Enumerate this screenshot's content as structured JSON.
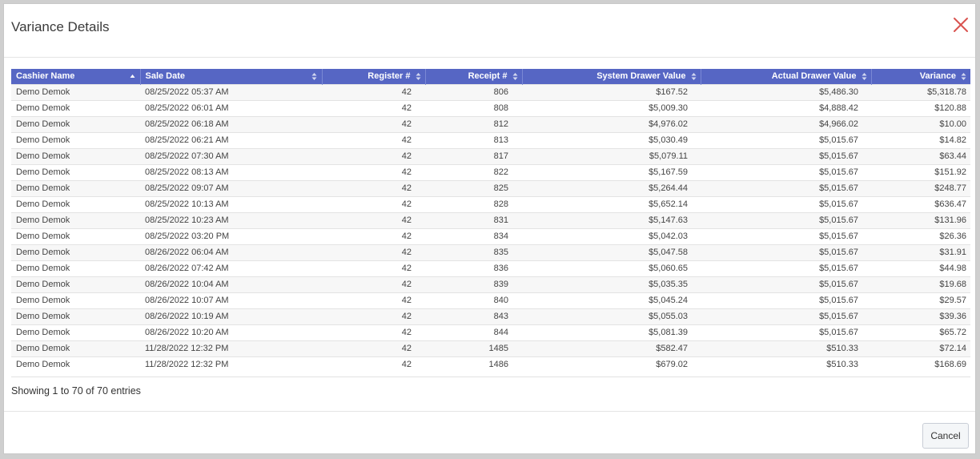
{
  "dialog": {
    "title": "Variance Details",
    "info_text": "Showing 1 to 70 of 70 entries",
    "cancel_label": "Cancel"
  },
  "colors": {
    "header_bg": "#5666c4",
    "close": "#d9534f"
  },
  "table": {
    "columns": [
      {
        "label": "Cashier Name",
        "key": "cashier",
        "align": "left"
      },
      {
        "label": "Sale Date",
        "key": "date",
        "align": "left"
      },
      {
        "label": "Register #",
        "key": "register",
        "align": "right"
      },
      {
        "label": "Receipt #",
        "key": "receipt",
        "align": "right"
      },
      {
        "label": "System Drawer Value",
        "key": "system",
        "align": "right"
      },
      {
        "label": "Actual Drawer Value",
        "key": "actual",
        "align": "right"
      },
      {
        "label": "Variance",
        "key": "variance",
        "align": "right"
      }
    ],
    "rows": [
      {
        "cashier": "Demo Demok",
        "date": "08/25/2022 05:37 AM",
        "register": "42",
        "receipt": "806",
        "system": "$167.52",
        "actual": "$5,486.30",
        "variance": "$5,318.78"
      },
      {
        "cashier": "Demo Demok",
        "date": "08/25/2022 06:01 AM",
        "register": "42",
        "receipt": "808",
        "system": "$5,009.30",
        "actual": "$4,888.42",
        "variance": "$120.88"
      },
      {
        "cashier": "Demo Demok",
        "date": "08/25/2022 06:18 AM",
        "register": "42",
        "receipt": "812",
        "system": "$4,976.02",
        "actual": "$4,966.02",
        "variance": "$10.00"
      },
      {
        "cashier": "Demo Demok",
        "date": "08/25/2022 06:21 AM",
        "register": "42",
        "receipt": "813",
        "system": "$5,030.49",
        "actual": "$5,015.67",
        "variance": "$14.82"
      },
      {
        "cashier": "Demo Demok",
        "date": "08/25/2022 07:30 AM",
        "register": "42",
        "receipt": "817",
        "system": "$5,079.11",
        "actual": "$5,015.67",
        "variance": "$63.44"
      },
      {
        "cashier": "Demo Demok",
        "date": "08/25/2022 08:13 AM",
        "register": "42",
        "receipt": "822",
        "system": "$5,167.59",
        "actual": "$5,015.67",
        "variance": "$151.92"
      },
      {
        "cashier": "Demo Demok",
        "date": "08/25/2022 09:07 AM",
        "register": "42",
        "receipt": "825",
        "system": "$5,264.44",
        "actual": "$5,015.67",
        "variance": "$248.77"
      },
      {
        "cashier": "Demo Demok",
        "date": "08/25/2022 10:13 AM",
        "register": "42",
        "receipt": "828",
        "system": "$5,652.14",
        "actual": "$5,015.67",
        "variance": "$636.47"
      },
      {
        "cashier": "Demo Demok",
        "date": "08/25/2022 10:23 AM",
        "register": "42",
        "receipt": "831",
        "system": "$5,147.63",
        "actual": "$5,015.67",
        "variance": "$131.96"
      },
      {
        "cashier": "Demo Demok",
        "date": "08/25/2022 03:20 PM",
        "register": "42",
        "receipt": "834",
        "system": "$5,042.03",
        "actual": "$5,015.67",
        "variance": "$26.36"
      },
      {
        "cashier": "Demo Demok",
        "date": "08/26/2022 06:04 AM",
        "register": "42",
        "receipt": "835",
        "system": "$5,047.58",
        "actual": "$5,015.67",
        "variance": "$31.91"
      },
      {
        "cashier": "Demo Demok",
        "date": "08/26/2022 07:42 AM",
        "register": "42",
        "receipt": "836",
        "system": "$5,060.65",
        "actual": "$5,015.67",
        "variance": "$44.98"
      },
      {
        "cashier": "Demo Demok",
        "date": "08/26/2022 10:04 AM",
        "register": "42",
        "receipt": "839",
        "system": "$5,035.35",
        "actual": "$5,015.67",
        "variance": "$19.68"
      },
      {
        "cashier": "Demo Demok",
        "date": "08/26/2022 10:07 AM",
        "register": "42",
        "receipt": "840",
        "system": "$5,045.24",
        "actual": "$5,015.67",
        "variance": "$29.57"
      },
      {
        "cashier": "Demo Demok",
        "date": "08/26/2022 10:19 AM",
        "register": "42",
        "receipt": "843",
        "system": "$5,055.03",
        "actual": "$5,015.67",
        "variance": "$39.36"
      },
      {
        "cashier": "Demo Demok",
        "date": "08/26/2022 10:20 AM",
        "register": "42",
        "receipt": "844",
        "system": "$5,081.39",
        "actual": "$5,015.67",
        "variance": "$65.72"
      },
      {
        "cashier": "Demo Demok",
        "date": "11/28/2022 12:32 PM",
        "register": "42",
        "receipt": "1485",
        "system": "$582.47",
        "actual": "$510.33",
        "variance": "$72.14"
      },
      {
        "cashier": "Demo Demok",
        "date": "11/28/2022 12:32 PM",
        "register": "42",
        "receipt": "1486",
        "system": "$679.02",
        "actual": "$510.33",
        "variance": "$168.69"
      }
    ]
  }
}
